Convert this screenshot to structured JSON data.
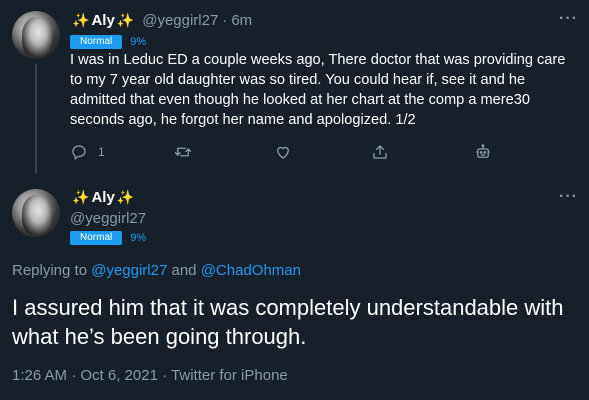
{
  "tweet1": {
    "display_name": "Aly",
    "handle": "@yeggirl27",
    "separator": "·",
    "time": "6m",
    "badge": "Normal",
    "percent": "9%",
    "text": "I was in Leduc ED a couple weeks ago, There doctor that was providing care to my 7 year old daughter was so tired. You could hear if, see it and he admitted that even though he looked at her chart at the comp a mere30 seconds ago, he forgot her name and apologized. 1/2",
    "reply_count": "1",
    "icons": [
      "reply-icon",
      "retweet-icon",
      "like-icon",
      "share-icon",
      "bot-icon"
    ]
  },
  "tweet2": {
    "display_name": "Aly",
    "handle": "@yeggirl27",
    "badge": "Normal",
    "percent": "9%",
    "replying_prefix": "Replying to",
    "replying_user1": "@yeggirl27",
    "replying_and": "and",
    "replying_user2": "@ChadOhman",
    "text": "I assured him that it was completely understandable with what he’s been going through.",
    "time": "1:26 AM",
    "date": "Oct 6, 2021",
    "separator": "·",
    "source": "Twitter for iPhone"
  },
  "more_label": "···",
  "sparkle": "✨",
  "colors": {
    "background": "#15202b",
    "accent": "#1d9bf0",
    "muted": "#8899a6",
    "sparkle": "#ffcc4d"
  }
}
